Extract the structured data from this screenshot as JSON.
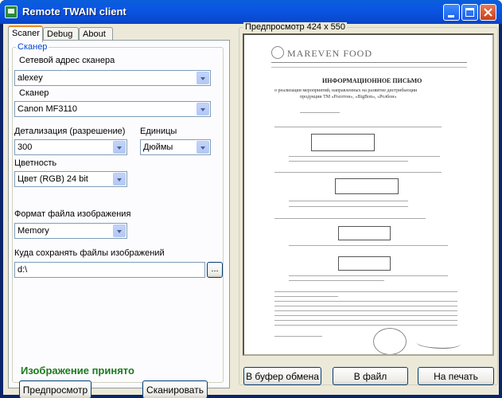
{
  "window": {
    "title": "Remote TWAIN client"
  },
  "tabs": [
    {
      "label": "Scaner"
    },
    {
      "label": "Debug"
    },
    {
      "label": "About"
    }
  ],
  "scanner_group": {
    "title": "Сканер",
    "network_address_label": "Сетевой адрес сканера",
    "network_address_value": "alexey",
    "scanner_label": "Сканер",
    "scanner_value": "Canon MF3110",
    "resolution_label": "Детализация (разрешение)",
    "resolution_value": "300",
    "units_label": "Единицы",
    "units_value": "Дюймы",
    "color_label": "Цветность",
    "color_value": "Цвет (RGB) 24 bit",
    "format_label": "Формат файла изображения",
    "format_value": "Memory",
    "save_path_label": "Куда сохранять файлы изображений",
    "save_path_value": "d:\\",
    "browse_label": "..."
  },
  "status_text": "Изображение принято",
  "buttons": {
    "preview": "Предпросмотр",
    "scan": "Сканировать",
    "clipboard": "В буфер обмена",
    "to_file": "В файл",
    "print": "На печать"
  },
  "preview": {
    "label": "Предпросмотр   424 x 550",
    "document": {
      "logo": "MAREVEN FOOD",
      "heading": "ИНФОРМАЦИОННОЕ ПИСЬМО",
      "subtitle_1": "о реализации мероприятий, направленных на развитие дистрибьюции",
      "subtitle_2": "продукции ТМ «Роллтон», «BigBon», «Ролбон»"
    }
  },
  "colors": {
    "titlebar": "#0b55e4",
    "status_green": "#1e7a1e",
    "group_label": "#0046d5",
    "face": "#ece9d8"
  }
}
